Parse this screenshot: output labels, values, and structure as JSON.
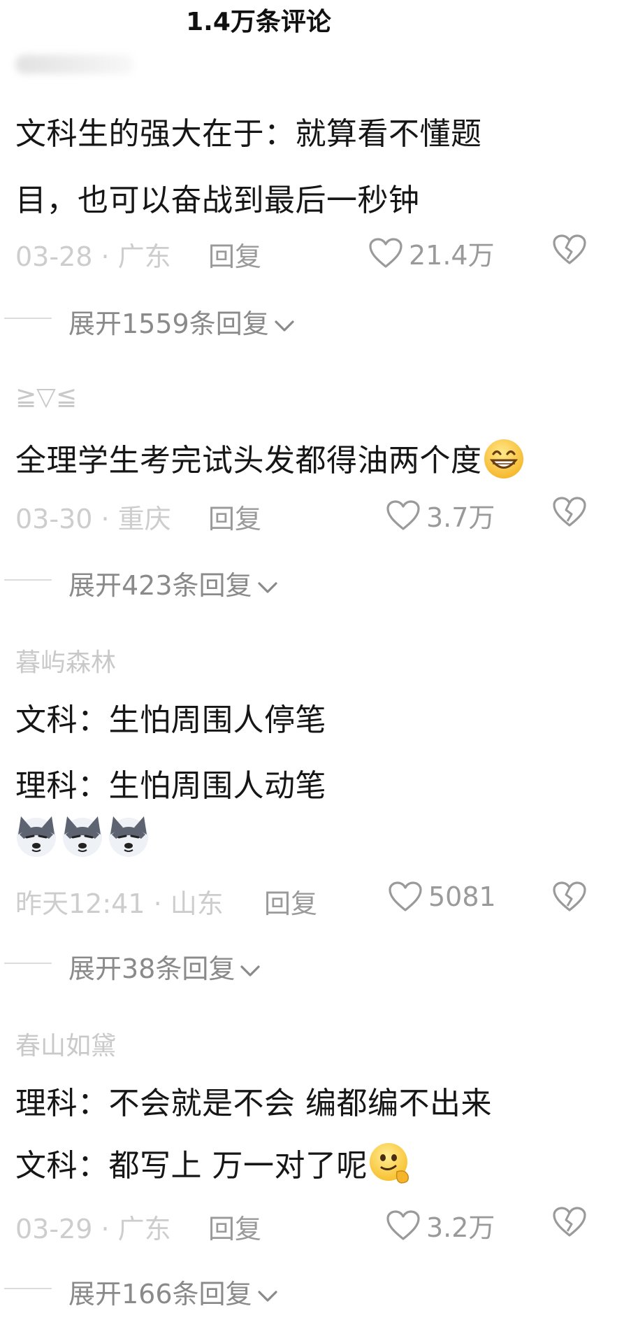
{
  "header": {
    "title": "1.4万条评论"
  },
  "comments": [
    {
      "username": "",
      "lines": [
        "文科生的强大在于：就算看不懂题",
        "目，也可以奋战到最后一秒钟"
      ],
      "time_location": "03-28 · 广东",
      "reply_label": "回复",
      "likes": "21.4万",
      "expand_label": "展开1559条回复"
    },
    {
      "username": "≧▽≦",
      "lines": [
        "全理学生考完试头发都得油两个度"
      ],
      "time_location": "03-30 · 重庆",
      "reply_label": "回复",
      "likes": "3.7万",
      "expand_label": "展开423条回复"
    },
    {
      "username": "暮屿森林",
      "lines": [
        "文科：生怕周围人停笔",
        "理科：生怕周围人动笔"
      ],
      "time_location": "昨天12:41 · 山东",
      "reply_label": "回复",
      "likes": "5081",
      "expand_label": "展开38条回复"
    },
    {
      "username": "春山如黛",
      "lines": [
        "理科：不会就是不会 编都编不出来",
        "文科：都写上 万一对了呢"
      ],
      "time_location": "03-29 · 广东",
      "reply_label": "回复",
      "likes": "3.2万",
      "expand_label": "展开166条回复"
    }
  ],
  "icons": {
    "like": "heart-outline-icon",
    "dislike": "broken-heart-icon",
    "expand": "chevron-down-icon",
    "emoji_grin": "grinning-emoji",
    "emoji_husky": "husky-dog-emoji",
    "emoji_smirk": "smirk-emoji"
  },
  "colors": {
    "text": "#161616",
    "meta": "#cdcdcd",
    "action": "#9a9a9a",
    "username": "#c9c9c9"
  }
}
